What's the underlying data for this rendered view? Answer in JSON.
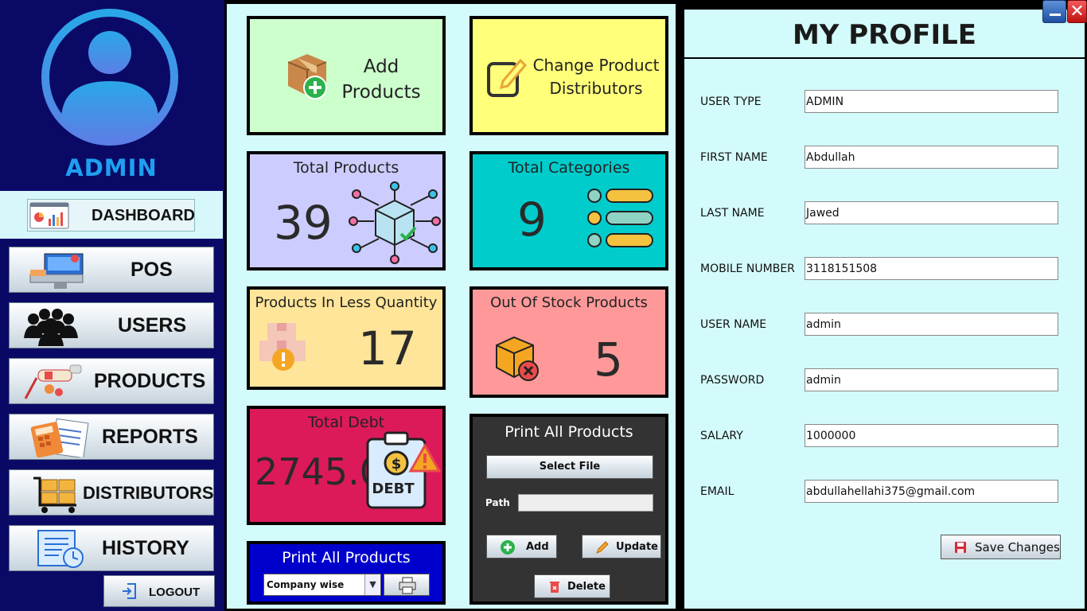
{
  "sidebar": {
    "role": "ADMIN",
    "dashboard_label": "DASHBOARD",
    "nav": [
      {
        "label": "POS",
        "icon": "pos-terminal-icon"
      },
      {
        "label": "USERS",
        "icon": "users-group-icon"
      },
      {
        "label": "PRODUCTS",
        "icon": "products-icon"
      },
      {
        "label": "REPORTS",
        "icon": "calculator-reports-icon"
      },
      {
        "label": "DISTRIBUTORS",
        "icon": "cart-boxes-icon"
      },
      {
        "label": "HISTORY",
        "icon": "receipt-clock-icon"
      }
    ],
    "logout_label": "LOGOUT"
  },
  "dashboard": {
    "add_products": {
      "line1": "Add",
      "line2": "Products"
    },
    "change_distributors": {
      "line1": "Change Product",
      "line2": "Distributors"
    },
    "total_products": {
      "title": "Total Products",
      "value": "39"
    },
    "total_categories": {
      "title": "Total Categories",
      "value": "9"
    },
    "less_quantity": {
      "title": "Products In Less Quantity",
      "value": "17"
    },
    "out_of_stock": {
      "title": "Out Of Stock Products",
      "value": "5"
    },
    "total_debt": {
      "title": "Total Debt",
      "value": "2745.0",
      "icon_text": "DEBT"
    },
    "print_company": {
      "title": "Print All Products",
      "select_value": "Company wise"
    },
    "print_file": {
      "title": "Print All Products",
      "select_file_label": "Select File",
      "path_label": "Path",
      "path_value": "",
      "add_label": "Add",
      "update_label": "Update",
      "delete_label": "Delete"
    },
    "colors": {
      "add": "#ccffcc",
      "change": "#ffff7a",
      "total_products": "#ccccff",
      "categories": "#00cccc",
      "less": "#ffe599",
      "out": "#ff9999",
      "debt": "#dc1a5a",
      "print_company": "#0000cc",
      "print_file": "#333333"
    }
  },
  "profile": {
    "title": "MY PROFILE",
    "fields": [
      {
        "label": "USER TYPE",
        "value": "ADMIN"
      },
      {
        "label": "FIRST NAME",
        "value": "Abdullah"
      },
      {
        "label": "LAST NAME",
        "value": "Jawed"
      },
      {
        "label": "MOBILE NUMBER",
        "value": "3118151508"
      },
      {
        "label": "USER NAME",
        "value": "admin"
      },
      {
        "label": "PASSWORD",
        "value": "admin"
      },
      {
        "label": "SALARY",
        "value": "1000000"
      },
      {
        "label": "EMAIL",
        "value": "abdullahellahi375@gmail.com"
      }
    ],
    "save_label": "Save Changes"
  }
}
